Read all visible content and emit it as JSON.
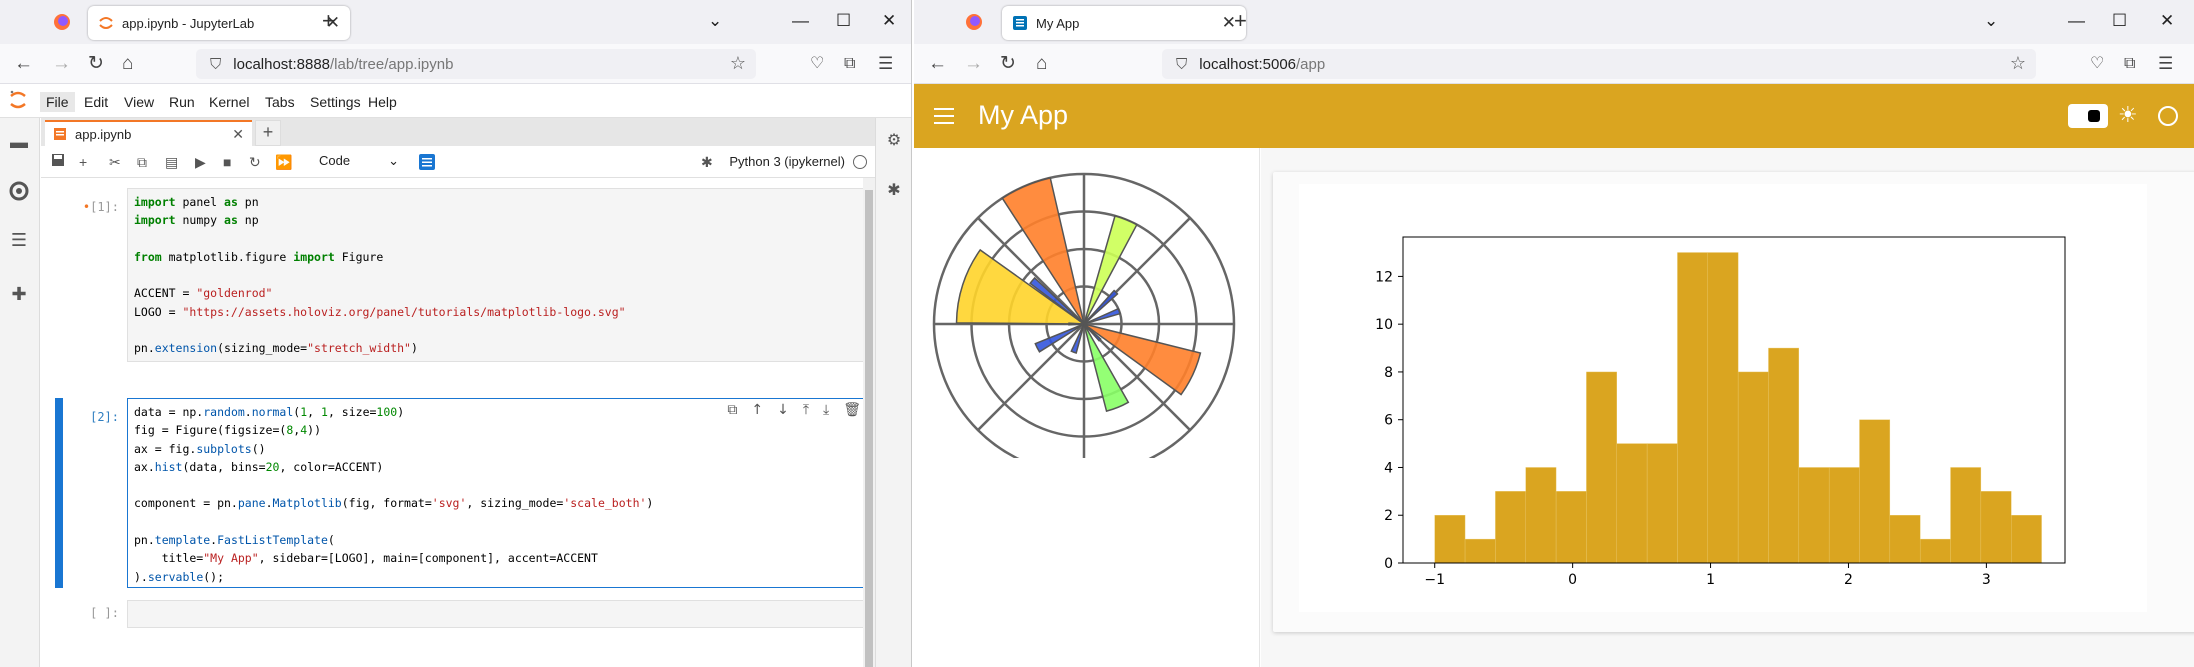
{
  "left_window": {
    "tab_title": "app.ipynb - JupyterLab",
    "url_host": "localhost:8888",
    "url_path": "/lab/tree/app.ipynb",
    "menu": [
      "File",
      "Edit",
      "View",
      "Run",
      "Kernel",
      "Tabs",
      "Settings",
      "Help"
    ],
    "notebook_tab": "app.ipynb",
    "cell_type": "Code",
    "kernel": "Python 3 (ipykernel)",
    "cells": [
      {
        "prompt": "[1]:",
        "prefix": "•"
      },
      {
        "prompt": "[2]:"
      },
      {
        "prompt": "[ ]:"
      }
    ]
  },
  "right_window": {
    "tab_title": "My App",
    "url_host": "localhost:5006",
    "url_path": "/app",
    "app_title": "My App",
    "accent": "#daa520"
  },
  "chart_data": [
    {
      "type": "bar",
      "title": "",
      "xlabel": "",
      "ylabel": "",
      "xticks": [
        "−1",
        "0",
        "1",
        "2",
        "3"
      ],
      "yticks": [
        "0",
        "2",
        "4",
        "6",
        "8",
        "10",
        "12"
      ],
      "ylim": [
        0,
        13.65
      ],
      "xlim": [
        -1.23,
        3.57
      ],
      "bin_edges": [
        -1.0,
        -0.78,
        -0.56,
        -0.34,
        -0.12,
        0.1,
        0.32,
        0.54,
        0.76,
        0.98,
        1.2,
        1.42,
        1.64,
        1.86,
        2.08,
        2.3,
        2.52,
        2.74,
        2.96,
        3.18,
        3.4
      ],
      "values": [
        2,
        1,
        3,
        4,
        3,
        8,
        5,
        5,
        13,
        13,
        8,
        9,
        4,
        4,
        6,
        2,
        1,
        4,
        3,
        2
      ],
      "color": "#daa520",
      "grid": false
    },
    {
      "type": "polar_bar",
      "title": "",
      "theta_deg": [
        162,
        113,
        68,
        20,
        335,
        292,
        250,
        207,
        180,
        140,
        45,
        315
      ],
      "radius": [
        0.85,
        1.0,
        0.75,
        0.25,
        0.8,
        0.6,
        0.2,
        0.35,
        0.1,
        0.45,
        0.3,
        0.15
      ],
      "width_deg": [
        35,
        20,
        12,
        8,
        22,
        15,
        10,
        10,
        6,
        6,
        6,
        6
      ],
      "colors": [
        "#ffd42a",
        "#ff7f2a",
        "#ccff55",
        "#3355dd",
        "#ff7f2a",
        "#88ff66",
        "#3355dd",
        "#3355dd",
        "#3355dd",
        "#3355dd",
        "#3355dd",
        "#3355dd"
      ],
      "grid": true
    }
  ]
}
